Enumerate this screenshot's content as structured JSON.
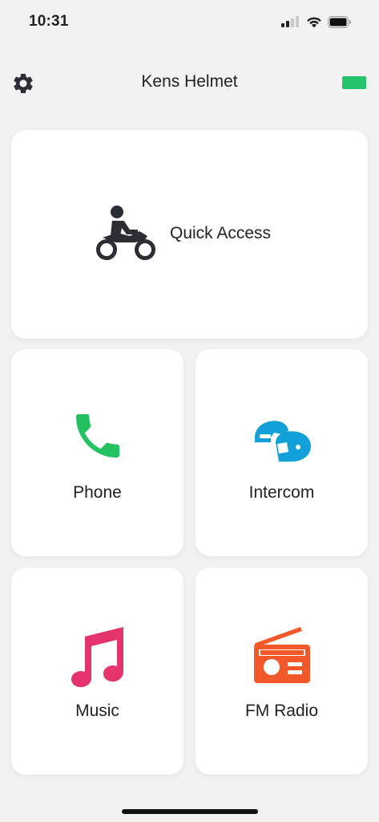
{
  "status_bar": {
    "time": "10:31",
    "icons": [
      "signal-icon",
      "wifi-icon",
      "battery-icon"
    ]
  },
  "header": {
    "title": "Kens Helmet",
    "settings_icon": "gear-icon",
    "battery_color": "#25c46b"
  },
  "tiles": {
    "quick_access": {
      "label": "Quick Access",
      "icon": "motorcycle-icon",
      "color": "#2b2e35"
    },
    "phone": {
      "label": "Phone",
      "icon": "phone-icon",
      "color": "#22c35f"
    },
    "intercom": {
      "label": "Intercom",
      "icon": "helmets-icon",
      "color": "#12a0d8"
    },
    "music": {
      "label": "Music",
      "icon": "music-note-icon",
      "color": "#e5336b"
    },
    "fm_radio": {
      "label": "FM Radio",
      "icon": "radio-icon",
      "color": "#f2582a"
    }
  }
}
